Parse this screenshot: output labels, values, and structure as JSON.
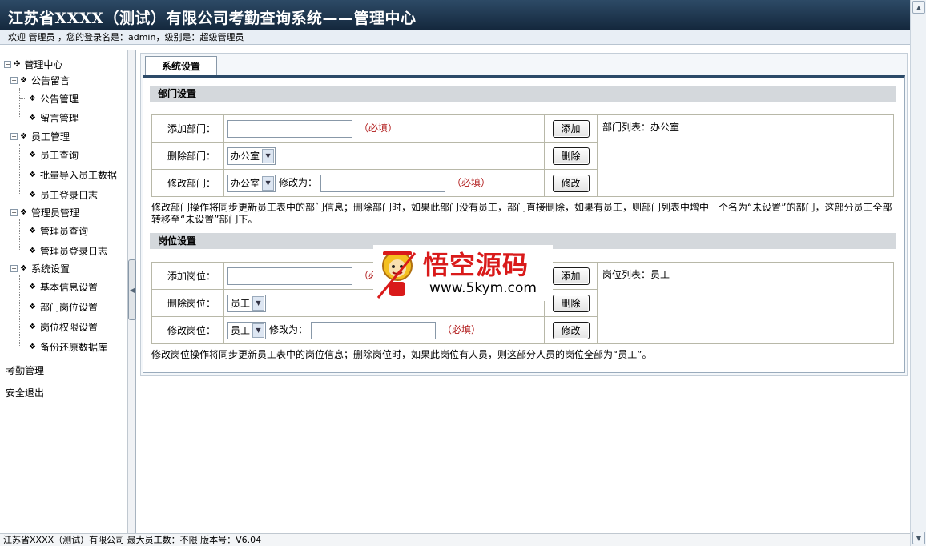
{
  "header": {
    "title": "江苏省XXXX（测试）有限公司考勤查询系统——管理中心",
    "welcome": "欢迎 管理员 ，您的登录名是：admin，级别是：超级管理员"
  },
  "sidebar": {
    "root": "管理中心",
    "groups": [
      {
        "label": "公告留言",
        "items": [
          "公告管理",
          "留言管理"
        ]
      },
      {
        "label": "员工管理",
        "items": [
          "员工查询",
          "批量导入员工数据",
          "员工登录日志"
        ]
      },
      {
        "label": "管理员管理",
        "items": [
          "管理员查询",
          "管理员登录日志"
        ]
      },
      {
        "label": "系统设置",
        "items": [
          "基本信息设置",
          "部门岗位设置",
          "岗位权限设置",
          "备份还原数据库"
        ]
      }
    ],
    "links": [
      "考勤管理",
      "安全退出"
    ]
  },
  "tab": {
    "label": "系统设置"
  },
  "department": {
    "header": "部门设置",
    "add_label": "添加部门：",
    "add_value": "",
    "required": "（必填）",
    "add_button": "添加",
    "delete_label": "删除部门：",
    "delete_selected": "办公室",
    "delete_button": "删除",
    "edit_label": "修改部门：",
    "edit_selected": "办公室",
    "edit_to_label": "修改为：",
    "edit_value": "",
    "edit_button": "修改",
    "list_label": "部门列表：办公室",
    "note": "修改部门操作将同步更新员工表中的部门信息；删除部门时，如果此部门没有员工，部门直接删除，如果有员工，则部门列表中增中一个名为“未设置”的部门，这部分员工全部转移至“未设置”部门下。"
  },
  "position": {
    "header": "岗位设置",
    "add_label": "添加岗位：",
    "add_value": "",
    "required": "（必填）",
    "add_button": "添加",
    "delete_label": "删除岗位：",
    "delete_selected": "员工",
    "delete_button": "删除",
    "edit_label": "修改岗位：",
    "edit_selected": "员工",
    "edit_to_label": "修改为：",
    "edit_value": "",
    "edit_button": "修改",
    "list_label": "岗位列表：员工",
    "note": "修改岗位操作将同步更新员工表中的岗位信息；删除岗位时，如果此岗位有人员，则这部分人员的岗位全部为“员工”。"
  },
  "watermark": {
    "title": "悟空源码",
    "url": "www.5kym.com"
  },
  "status": {
    "text": "江苏省XXXX（测试）有限公司   最大员工数：不限   版本号：V6.04"
  },
  "colors": {
    "header_bg": "#1e3650",
    "required": "#b01818",
    "section_bg": "#d4d8dc",
    "watermark_red": "#d91a1a"
  }
}
